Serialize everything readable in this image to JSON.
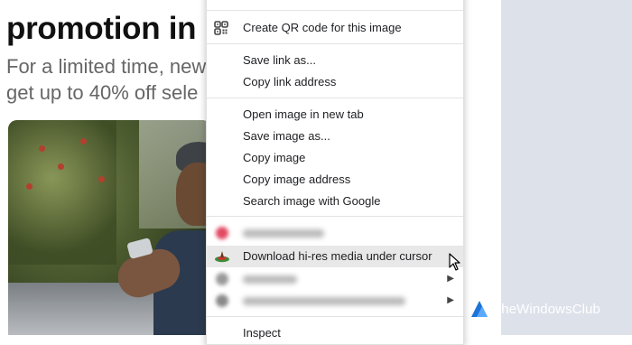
{
  "page": {
    "headline_line1": "",
    "headline_line2": "promotion in l",
    "subtext_line1": "For a limited time, new",
    "subtext_line2": "get up to 40% off sele"
  },
  "context_menu": {
    "items": [
      {
        "label": "Create QR code for this image",
        "icon": "qr-code-icon"
      },
      {
        "label": "Save link as..."
      },
      {
        "label": "Copy link address"
      },
      {
        "label": "Open image in new tab"
      },
      {
        "label": "Save image as..."
      },
      {
        "label": "Copy image"
      },
      {
        "label": "Copy image address"
      },
      {
        "label": "Search image with Google"
      },
      {
        "label": "Download hi-res media under cursor",
        "icon": "extension-download-icon"
      },
      {
        "label": "Inspect"
      }
    ],
    "hover_color": "#e8e8e8"
  },
  "watermark": {
    "text": "TheWindowsClub",
    "color": "#ffffff",
    "logo_color": "#1e73d8"
  }
}
